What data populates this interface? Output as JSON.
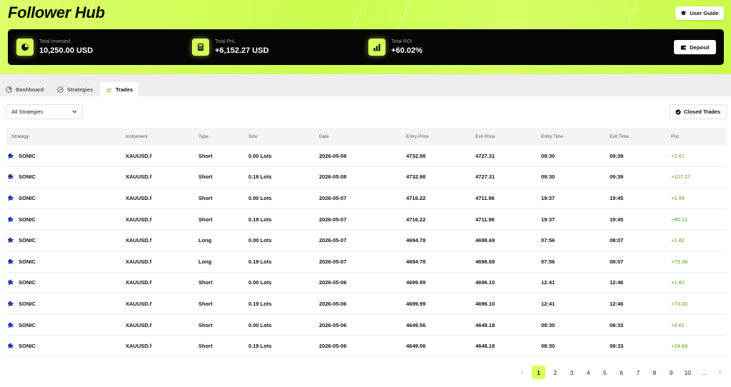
{
  "app": {
    "title": "Follower Hub"
  },
  "header": {
    "user_guide_label": "User Guide",
    "deposit_label": "Deposit",
    "stats": [
      {
        "label": "Total Invested",
        "value": "10,250.00 USD",
        "icon": "pie-chart-icon"
      },
      {
        "label": "Total PnL",
        "value": "+6,152.27 USD",
        "icon": "calculator-icon"
      },
      {
        "label": "Total ROI",
        "value": "+60.02%",
        "icon": "bar-chart-icon"
      }
    ]
  },
  "tabs": [
    {
      "label": "Dashboard",
      "icon": "dashboard-icon",
      "active": false
    },
    {
      "label": "Strategies",
      "icon": "strategies-icon",
      "active": false
    },
    {
      "label": "Trades",
      "icon": "trades-icon",
      "active": true
    }
  ],
  "filters": {
    "strategy_select": "All Strategies",
    "closed_trades_label": "Closed Trades"
  },
  "table": {
    "columns": [
      "Strategy",
      "Instrument",
      "Type",
      "Size",
      "Date",
      "Entry Price",
      "Exit Price",
      "Entry Time",
      "Exit Time",
      "PnL"
    ],
    "rows": [
      {
        "strategy": "SONIC",
        "instrument": "XAUUSD.f",
        "type": "Short",
        "size": "0.00 Lots",
        "date": "2026-05-08",
        "entry_price": "4732.98",
        "exit_price": "4727.31",
        "entry_time": "09:30",
        "exit_time": "09:39",
        "pnl": "+2.67"
      },
      {
        "strategy": "SONIC",
        "instrument": "XAUUSD.f",
        "type": "Short",
        "size": "0.19 Lots",
        "date": "2026-05-08",
        "entry_price": "4732.98",
        "exit_price": "4727.31",
        "entry_time": "09:30",
        "exit_time": "09:39",
        "pnl": "+107.27"
      },
      {
        "strategy": "SONIC",
        "instrument": "XAUUSD.f",
        "type": "Short",
        "size": "0.00 Lots",
        "date": "2026-05-07",
        "entry_price": "4716.22",
        "exit_price": "4711.96",
        "entry_time": "19:37",
        "exit_time": "19:45",
        "pnl": "+1.99"
      },
      {
        "strategy": "SONIC",
        "instrument": "XAUUSD.f",
        "type": "Short",
        "size": "0.19 Lots",
        "date": "2026-05-07",
        "entry_price": "4716.22",
        "exit_price": "4711.96",
        "entry_time": "19:37",
        "exit_time": "19:45",
        "pnl": "+80.12"
      },
      {
        "strategy": "SONIC",
        "instrument": "XAUUSD.f",
        "type": "Long",
        "size": "0.00 Lots",
        "date": "2026-05-07",
        "entry_price": "4694.78",
        "exit_price": "4698.69",
        "entry_time": "07:56",
        "exit_time": "08:07",
        "pnl": "+1.82"
      },
      {
        "strategy": "SONIC",
        "instrument": "XAUUSD.f",
        "type": "Long",
        "size": "0.19 Lots",
        "date": "2026-05-07",
        "entry_price": "4694.78",
        "exit_price": "4698.69",
        "entry_time": "07:56",
        "exit_time": "08:07",
        "pnl": "+73.38"
      },
      {
        "strategy": "SONIC",
        "instrument": "XAUUSD.f",
        "type": "Short",
        "size": "0.00 Lots",
        "date": "2026-05-06",
        "entry_price": "4699.99",
        "exit_price": "4696.10",
        "entry_time": "12:41",
        "exit_time": "12:46",
        "pnl": "+1.82"
      },
      {
        "strategy": "SONIC",
        "instrument": "XAUUSD.f",
        "type": "Short",
        "size": "0.19 Lots",
        "date": "2026-05-06",
        "entry_price": "4699.99",
        "exit_price": "4696.10",
        "entry_time": "12:41",
        "exit_time": "12:46",
        "pnl": "+73.00"
      },
      {
        "strategy": "SONIC",
        "instrument": "XAUUSD.f",
        "type": "Short",
        "size": "0.00 Lots",
        "date": "2026-05-06",
        "entry_price": "4649.56",
        "exit_price": "4648.18",
        "entry_time": "08:30",
        "exit_time": "08:33",
        "pnl": "+0.61"
      },
      {
        "strategy": "SONIC",
        "instrument": "XAUUSD.f",
        "type": "Short",
        "size": "0.19 Lots",
        "date": "2026-05-06",
        "entry_price": "4649.56",
        "exit_price": "4648.18",
        "entry_time": "08:30",
        "exit_time": "08:33",
        "pnl": "+24.66"
      }
    ]
  },
  "pagination": {
    "prev": "‹",
    "next": "›",
    "pages": [
      "1",
      "2",
      "3",
      "4",
      "5",
      "6",
      "7",
      "8",
      "9",
      "10",
      "..."
    ],
    "current": "1"
  },
  "colors": {
    "accent": "#d7ff5a",
    "pnl_positive": "#55a11a",
    "card_bg": "#060606"
  }
}
